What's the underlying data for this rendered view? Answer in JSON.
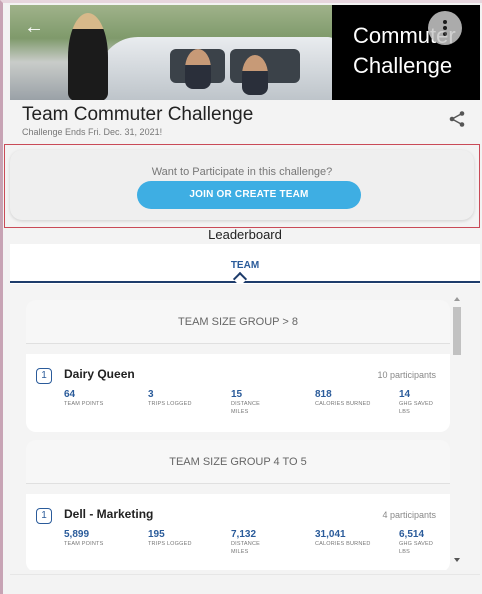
{
  "banner": {
    "title_line1": "Commuter",
    "title_line2": "Challenge",
    "back_icon": "arrow-left-icon",
    "menu_icon": "kebab-menu-icon"
  },
  "header": {
    "title": "Team Commuter Challenge",
    "subtitle": "Challenge Ends Fri. Dec. 31, 2021!",
    "share_icon": "share-icon"
  },
  "join": {
    "prompt": "Want to Participate in this challenge?",
    "button_label": "JOIN OR CREATE TEAM"
  },
  "leaderboard": {
    "label": "Leaderboard",
    "tab": "TEAM"
  },
  "groups": [
    {
      "title": "TEAM SIZE GROUP > 8",
      "team": {
        "rank": "1",
        "name": "Dairy Queen",
        "participants": "10 participants",
        "stats": [
          {
            "value": "64",
            "label": "TEAM POINTS"
          },
          {
            "value": "3",
            "label": "TRIPS LOGGED"
          },
          {
            "value": "15",
            "label": "DISTANCE",
            "label2": "MILES"
          },
          {
            "value": "818",
            "label": "CALORIES BURNED"
          },
          {
            "value": "14",
            "label": "GHG SAVED",
            "label2": "LBS"
          }
        ]
      }
    },
    {
      "title": "TEAM SIZE GROUP 4 TO 5",
      "team": {
        "rank": "1",
        "name": "Dell - Marketing",
        "participants": "4 participants",
        "stats": [
          {
            "value": "5,899",
            "label": "TEAM POINTS"
          },
          {
            "value": "195",
            "label": "TRIPS LOGGED"
          },
          {
            "value": "7,132",
            "label": "DISTANCE",
            "label2": "MILES"
          },
          {
            "value": "31,041",
            "label": "CALORIES BURNED"
          },
          {
            "value": "6,514",
            "label": "GHG SAVED",
            "label2": "LBS"
          }
        ]
      }
    }
  ],
  "colors": {
    "accent": "#3eaee3",
    "brand_blue": "#2a5b9a",
    "highlight_border": "#c94a57"
  }
}
